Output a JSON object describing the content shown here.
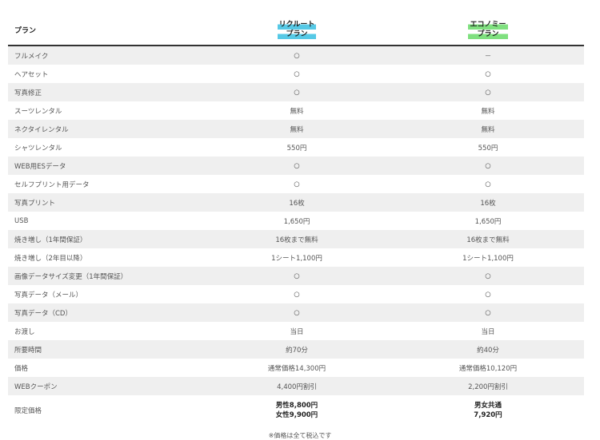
{
  "header": {
    "label": "プラン",
    "plan1": [
      "リクルート",
      "プラン"
    ],
    "plan2": [
      "エコノミー",
      "プラン"
    ]
  },
  "rows": [
    {
      "label": "フルメイク",
      "v1": "○",
      "v2": "－"
    },
    {
      "label": "ヘアセット",
      "v1": "○",
      "v2": "○"
    },
    {
      "label": "写真修正",
      "v1": "○",
      "v2": "○"
    },
    {
      "label": "スーツレンタル",
      "v1": "無料",
      "v2": "無料"
    },
    {
      "label": "ネクタイレンタル",
      "v1": "無料",
      "v2": "無料"
    },
    {
      "label": "シャツレンタル",
      "v1": "550円",
      "v2": "550円"
    },
    {
      "label": "WEB用ESデータ",
      "v1": "○",
      "v2": "○"
    },
    {
      "label": "セルフプリント用データ",
      "v1": "○",
      "v2": "○"
    },
    {
      "label": "写真プリント",
      "v1": "16枚",
      "v2": "16枚"
    },
    {
      "label": "USB",
      "v1": "1,650円",
      "v2": "1,650円"
    },
    {
      "label": "焼き増し（1年間保証）",
      "v1": "16枚まで無料",
      "v2": "16枚まで無料"
    },
    {
      "label": "焼き増し（2年目以降）",
      "v1": "1シート1,100円",
      "v2": "1シート1,100円"
    },
    {
      "label": "画像データサイズ変更（1年間保証）",
      "v1": "○",
      "v2": "○"
    },
    {
      "label": "写真データ（メール）",
      "v1": "○",
      "v2": "○"
    },
    {
      "label": "写真データ（CD）",
      "v1": "○",
      "v2": "○"
    },
    {
      "label": "お渡し",
      "v1": "当日",
      "v2": "当日"
    },
    {
      "label": "所要時間",
      "v1": "約70分",
      "v2": "約40分"
    },
    {
      "label": "価格",
      "v1": "通常価格14,300円",
      "v2": "通常価格10,120円"
    },
    {
      "label": "WEBクーポン",
      "v1": "4,400円割引",
      "v2": "2,200円割引"
    }
  ],
  "limited": {
    "label": "限定価格",
    "v1": [
      "男性8,800円",
      "女性9,900円"
    ],
    "v2": [
      "男女共通",
      "7,920円"
    ]
  },
  "note": "※価格は全て税込です"
}
